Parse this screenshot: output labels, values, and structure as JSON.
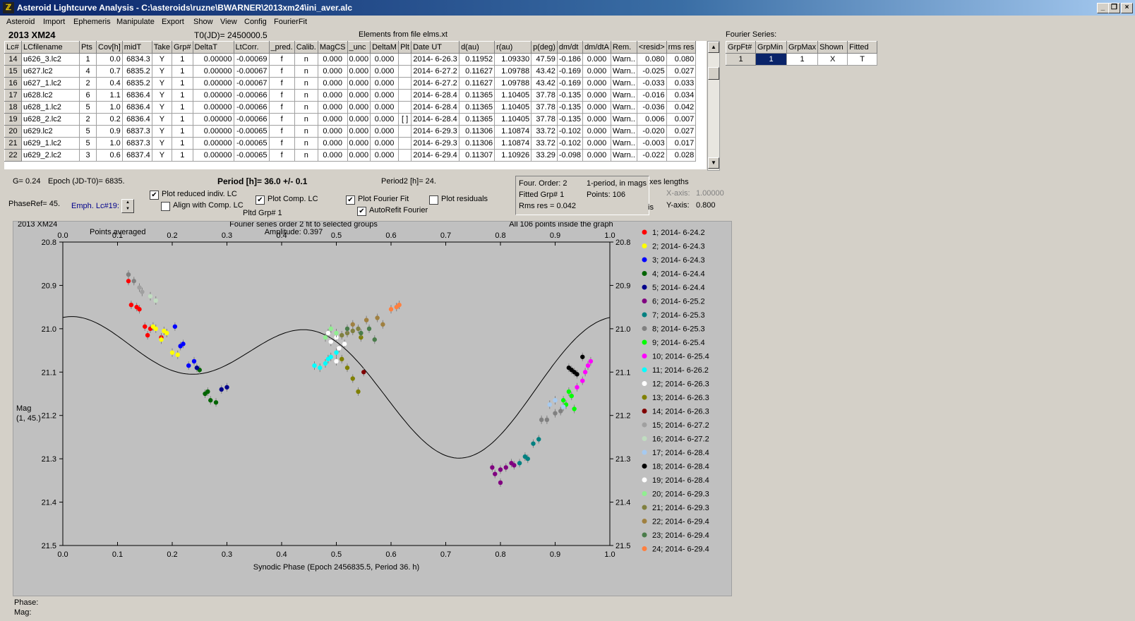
{
  "window": {
    "title": "Asteroid Lightcurve Analysis - C:\\asteroids\\ruzne\\BWARNER\\2013xm24\\ini_aver.alc"
  },
  "menu": [
    "Asteroid",
    "Import",
    "Ephemeris",
    "Manipulate",
    "Export",
    "Show",
    "View",
    "Config",
    "FourierFit"
  ],
  "header": {
    "object": "2013 XM24",
    "t0": "T0(JD)= 2450000.5",
    "elements": "Elements from file elms.xt"
  },
  "lc_table": {
    "columns": [
      "Lc#",
      "LCfilename",
      "Pts",
      "Cov[h]",
      "midT",
      "Take",
      "Grp#",
      "DeltaT",
      "LtCorr.",
      "_pred.",
      "Calib.",
      "MagCS",
      "_unc",
      "DeltaM",
      "Plt",
      "Date UT",
      "d(au)",
      "r(au)",
      "p(deg)",
      "dm/dt",
      "dm/dtA",
      "Rem.",
      "<resid>",
      "rms res"
    ],
    "rows": [
      [
        "14",
        "u626_3.lc2",
        "1",
        "0.0",
        "6834.3",
        "Y",
        "1",
        "0.00000",
        "-0.00069",
        "f",
        "n",
        "0.000",
        "0.000",
        "0.000",
        "",
        "2014- 6-26.3",
        "0.11952",
        "1.09330",
        "47.59",
        "-0.186",
        "0.000",
        "Warn..",
        "0.080",
        "0.080"
      ],
      [
        "15",
        "u627.lc2",
        "4",
        "0.7",
        "6835.2",
        "Y",
        "1",
        "0.00000",
        "-0.00067",
        "f",
        "n",
        "0.000",
        "0.000",
        "0.000",
        "",
        "2014- 6-27.2",
        "0.11627",
        "1.09788",
        "43.42",
        "-0.169",
        "0.000",
        "Warn..",
        "-0.025",
        "0.027"
      ],
      [
        "16",
        "u627_1.lc2",
        "2",
        "0.4",
        "6835.2",
        "Y",
        "1",
        "0.00000",
        "-0.00067",
        "f",
        "n",
        "0.000",
        "0.000",
        "0.000",
        "",
        "2014- 6-27.2",
        "0.11627",
        "1.09788",
        "43.42",
        "-0.169",
        "0.000",
        "Warn..",
        "-0.033",
        "0.033"
      ],
      [
        "17",
        "u628.lc2",
        "6",
        "1.1",
        "6836.4",
        "Y",
        "1",
        "0.00000",
        "-0.00066",
        "f",
        "n",
        "0.000",
        "0.000",
        "0.000",
        "",
        "2014- 6-28.4",
        "0.11365",
        "1.10405",
        "37.78",
        "-0.135",
        "0.000",
        "Warn..",
        "-0.016",
        "0.034"
      ],
      [
        "18",
        "u628_1.lc2",
        "5",
        "1.0",
        "6836.4",
        "Y",
        "1",
        "0.00000",
        "-0.00066",
        "f",
        "n",
        "0.000",
        "0.000",
        "0.000",
        "",
        "2014- 6-28.4",
        "0.11365",
        "1.10405",
        "37.78",
        "-0.135",
        "0.000",
        "Warn..",
        "-0.036",
        "0.042"
      ],
      [
        "19",
        "u628_2.lc2",
        "2",
        "0.2",
        "6836.4",
        "Y",
        "1",
        "0.00000",
        "-0.00066",
        "f",
        "n",
        "0.000",
        "0.000",
        "0.000",
        "[ ]",
        "2014- 6-28.4",
        "0.11365",
        "1.10405",
        "37.78",
        "-0.135",
        "0.000",
        "Warn..",
        "0.006",
        "0.007"
      ],
      [
        "20",
        "u629.lc2",
        "5",
        "0.9",
        "6837.3",
        "Y",
        "1",
        "0.00000",
        "-0.00065",
        "f",
        "n",
        "0.000",
        "0.000",
        "0.000",
        "",
        "2014- 6-29.3",
        "0.11306",
        "1.10874",
        "33.72",
        "-0.102",
        "0.000",
        "Warn..",
        "-0.020",
        "0.027"
      ],
      [
        "21",
        "u629_1.lc2",
        "5",
        "1.0",
        "6837.3",
        "Y",
        "1",
        "0.00000",
        "-0.00065",
        "f",
        "n",
        "0.000",
        "0.000",
        "0.000",
        "",
        "2014- 6-29.3",
        "0.11306",
        "1.10874",
        "33.72",
        "-0.102",
        "0.000",
        "Warn..",
        "-0.003",
        "0.017"
      ],
      [
        "22",
        "u629_2.lc2",
        "3",
        "0.6",
        "6837.4",
        "Y",
        "1",
        "0.00000",
        "-0.00065",
        "f",
        "n",
        "0.000",
        "0.000",
        "0.000",
        "",
        "2014- 6-29.4",
        "0.11307",
        "1.10926",
        "33.29",
        "-0.098",
        "0.000",
        "Warn..",
        "-0.022",
        "0.028"
      ]
    ]
  },
  "fourier_series": {
    "title": "Fourier Series:",
    "columns": [
      "GrpFt#",
      "GrpMin",
      "GrpMax",
      "Shown",
      "Fitted"
    ],
    "row": [
      "1",
      "1",
      "1",
      "X",
      "T"
    ]
  },
  "controls": {
    "g": "G= 0.24",
    "epoch": "Epoch (JD-T0)= 6835.",
    "period": "Period [h]= 36.0 +/- 0.1",
    "period2": "Period2 [h]= 24.",
    "phaseref": "PhaseRef= 45.",
    "emph": "Emph. Lc#19:",
    "plot_reduced": "Plot reduced indiv. LC",
    "align_comp": "Align with Comp. LC",
    "plot_comp": "Plot Comp. LC",
    "pltd_grp": "Pltd Grp#  1",
    "plot_fourier": "Plot Fourier Fit",
    "autorefit": "AutoRefit Fourier",
    "plot_residuals": "Plot residuals",
    "four_order": "Four. Order:  2",
    "one_period": "1-period, in mags",
    "fitted_grp": "Fitted Grp# 1",
    "points": "Points: 106",
    "rms": "Rms res     = 0.042",
    "axes_lengths": "xes lengths",
    "x_axis": "X-axis:",
    "x_axis_val": "1.00000",
    "y_axis": "Y-axis:",
    "y_axis_val": "0.800",
    "is_frag": "is"
  },
  "status": {
    "phase": "Phase:",
    "mag": "Mag:"
  },
  "chart_data": {
    "type": "scatter",
    "object_label": "2013 XM24",
    "title": "Fourier series order 2 fit to selected groups",
    "subtitle": "Amplitude: 0.397",
    "note_left": "Points averaged",
    "note_right": "All 106 points inside the graph",
    "xlabel": "Synodic Phase (Epoch 2456835.5, Period 36. h)",
    "ylabel": "Mag",
    "ylabel2": "(1, 45.)",
    "xlim": [
      0,
      1
    ],
    "ylim": [
      21.5,
      20.8
    ],
    "xticks": [
      "0.0",
      "0.1",
      "0.2",
      "0.3",
      "0.4",
      "0.5",
      "0.6",
      "0.7",
      "0.8",
      "0.9",
      "1.0"
    ],
    "yticks": [
      "20.8",
      "20.9",
      "21.0",
      "21.1",
      "21.2",
      "21.3",
      "21.4",
      "21.5"
    ],
    "fourier_fit": {
      "mean": 21.1,
      "a1": -0.028,
      "b1": -0.094,
      "a2": -0.098,
      "b2": 0.026
    },
    "series": [
      {
        "name": "1; 2014- 6-24.2",
        "color": "#ff0000",
        "points": [
          [
            0.12,
            20.89
          ],
          [
            0.125,
            20.945
          ],
          [
            0.135,
            20.95
          ],
          [
            0.14,
            20.955
          ],
          [
            0.15,
            20.995
          ],
          [
            0.16,
            21.0
          ],
          [
            0.155,
            21.015
          ],
          [
            0.18,
            21.02
          ]
        ]
      },
      {
        "name": "2; 2014- 6-24.3",
        "color": "#ffff00",
        "points": [
          [
            0.165,
            20.995
          ],
          [
            0.17,
            21.0
          ],
          [
            0.18,
            21.025
          ],
          [
            0.19,
            21.01
          ],
          [
            0.2,
            21.055
          ],
          [
            0.21,
            21.06
          ],
          [
            0.185,
            21.005
          ]
        ]
      },
      {
        "name": "3; 2014- 6-24.3",
        "color": "#0000ff",
        "points": [
          [
            0.205,
            20.995
          ],
          [
            0.215,
            21.04
          ],
          [
            0.22,
            21.035
          ],
          [
            0.23,
            21.085
          ],
          [
            0.24,
            21.075
          ]
        ]
      },
      {
        "name": "4; 2014- 6-24.4",
        "color": "#006400",
        "points": [
          [
            0.26,
            21.15
          ],
          [
            0.265,
            21.145
          ],
          [
            0.27,
            21.165
          ],
          [
            0.28,
            21.17
          ],
          [
            0.25,
            21.095
          ]
        ]
      },
      {
        "name": "5; 2014- 6-24.4",
        "color": "#00008b",
        "points": [
          [
            0.29,
            21.14
          ],
          [
            0.3,
            21.135
          ],
          [
            0.245,
            21.09
          ]
        ]
      },
      {
        "name": "6; 2014- 6-25.2",
        "color": "#800080",
        "points": [
          [
            0.785,
            21.32
          ],
          [
            0.79,
            21.335
          ],
          [
            0.8,
            21.325
          ],
          [
            0.81,
            21.32
          ],
          [
            0.82,
            21.31
          ],
          [
            0.825,
            21.315
          ],
          [
            0.8,
            21.355
          ]
        ]
      },
      {
        "name": "7; 2014- 6-25.3",
        "color": "#008080",
        "points": [
          [
            0.835,
            21.31
          ],
          [
            0.845,
            21.295
          ],
          [
            0.85,
            21.3
          ],
          [
            0.86,
            21.265
          ],
          [
            0.87,
            21.255
          ]
        ]
      },
      {
        "name": "8; 2014- 6-25.3",
        "color": "#808080",
        "points": [
          [
            0.875,
            21.21
          ],
          [
            0.885,
            21.21
          ],
          [
            0.9,
            21.195
          ],
          [
            0.91,
            21.19
          ],
          [
            0.12,
            20.875
          ],
          [
            0.13,
            20.89
          ]
        ]
      },
      {
        "name": "9; 2014- 6-25.4",
        "color": "#00ff00",
        "points": [
          [
            0.915,
            21.165
          ],
          [
            0.92,
            21.175
          ],
          [
            0.93,
            21.155
          ],
          [
            0.935,
            21.185
          ],
          [
            0.925,
            21.145
          ]
        ]
      },
      {
        "name": "10; 2014- 6-25.4",
        "color": "#ff00ff",
        "points": [
          [
            0.94,
            21.135
          ],
          [
            0.95,
            21.12
          ],
          [
            0.955,
            21.1
          ],
          [
            0.965,
            21.075
          ],
          [
            0.96,
            21.085
          ]
        ]
      },
      {
        "name": "11; 2014- 6-26.2",
        "color": "#00ffff",
        "points": [
          [
            0.46,
            21.085
          ],
          [
            0.47,
            21.09
          ],
          [
            0.48,
            21.08
          ],
          [
            0.485,
            21.07
          ],
          [
            0.49,
            21.065
          ],
          [
            0.5,
            21.055
          ]
        ]
      },
      {
        "name": "12; 2014- 6-26.3",
        "color": "#ffffff",
        "points": [
          [
            0.49,
            21.03
          ],
          [
            0.5,
            21.075
          ],
          [
            0.505,
            21.045
          ],
          [
            0.515,
            21.035
          ]
        ]
      },
      {
        "name": "13; 2014- 6-26.3",
        "color": "#808000",
        "points": [
          [
            0.51,
            21.07
          ],
          [
            0.52,
            21.09
          ],
          [
            0.53,
            21.115
          ],
          [
            0.54,
            21.145
          ],
          [
            0.545,
            21.02
          ]
        ]
      },
      {
        "name": "14; 2014- 6-26.3",
        "color": "#800000",
        "points": [
          [
            0.55,
            21.1
          ]
        ]
      },
      {
        "name": "15; 2014- 6-27.2",
        "color": "#a0a0a0",
        "points": [
          [
            0.14,
            20.905
          ],
          [
            0.145,
            20.915
          ]
        ]
      },
      {
        "name": "16; 2014- 6-27.2",
        "color": "#c0dcc0",
        "points": [
          [
            0.16,
            20.925
          ],
          [
            0.17,
            20.935
          ]
        ]
      },
      {
        "name": "17; 2014- 6-28.4",
        "color": "#a6caf0",
        "points": [
          [
            0.89,
            21.175
          ],
          [
            0.9,
            21.165
          ],
          [
            0.915,
            21.18
          ]
        ]
      },
      {
        "name": "18; 2014- 6-28.4",
        "color": "#000000",
        "points": [
          [
            0.925,
            21.09
          ],
          [
            0.93,
            21.095
          ],
          [
            0.935,
            21.1
          ],
          [
            0.94,
            21.105
          ],
          [
            0.95,
            21.065
          ]
        ]
      },
      {
        "name": "19; 2014- 6-28.4",
        "color": "#ffffff",
        "points": [
          [
            0.5,
            21.02
          ],
          [
            0.485,
            21.01
          ]
        ]
      },
      {
        "name": "20; 2014- 6-29.3",
        "color": "#90ee90",
        "points": [
          [
            0.48,
            21.02
          ],
          [
            0.49,
            21.0
          ],
          [
            0.5,
            21.01
          ]
        ]
      },
      {
        "name": "21; 2014- 6-29.3",
        "color": "#808040",
        "points": [
          [
            0.51,
            21.015
          ],
          [
            0.52,
            21.01
          ],
          [
            0.53,
            21.005
          ],
          [
            0.54,
            21.0
          ]
        ]
      },
      {
        "name": "22; 2014- 6-29.4",
        "color": "#a08040",
        "points": [
          [
            0.53,
            20.99
          ],
          [
            0.555,
            20.98
          ],
          [
            0.575,
            20.975
          ],
          [
            0.585,
            20.99
          ]
        ]
      },
      {
        "name": "23; 2014- 6-29.4",
        "color": "#4a7c4a",
        "points": [
          [
            0.52,
            21.0
          ],
          [
            0.545,
            21.01
          ],
          [
            0.56,
            21.0
          ],
          [
            0.57,
            21.025
          ]
        ]
      },
      {
        "name": "24; 2014- 6-29.4",
        "color": "#ff8040",
        "points": [
          [
            0.6,
            20.955
          ],
          [
            0.61,
            20.95
          ],
          [
            0.615,
            20.945
          ]
        ]
      }
    ]
  }
}
